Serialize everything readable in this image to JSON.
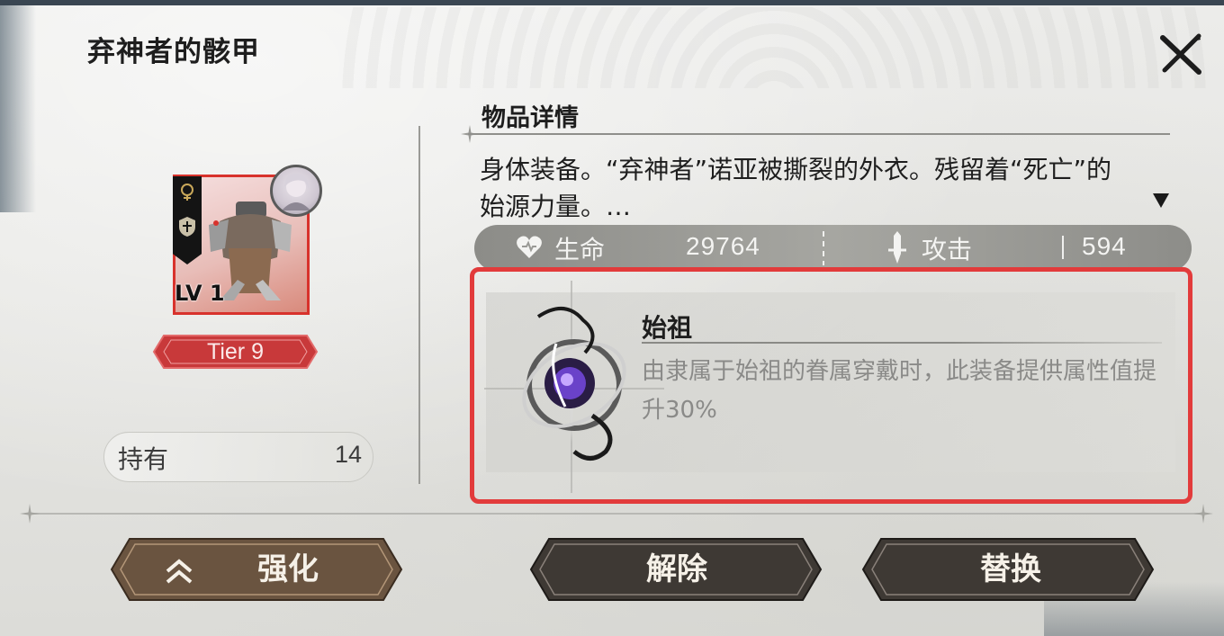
{
  "header": {
    "title": "弃神者的骸甲"
  },
  "item": {
    "level_label": "LV 1",
    "tier_label": "Tier 9",
    "hold": {
      "label": "持有",
      "value": "14"
    }
  },
  "details": {
    "section_title": "物品详情",
    "description": "身体装备。“弃神者”诺亚被撕裂的外衣。残留着“死亡”的始源力量。…",
    "stats": [
      {
        "icon": "heart-icon",
        "label": "生命",
        "value": "29764"
      },
      {
        "icon": "sword-icon",
        "label": "攻击",
        "value": "594"
      }
    ],
    "passive": {
      "name": "始祖",
      "description": "由隶属于始祖的眷属穿戴时，此装备提供属性值提升30%"
    }
  },
  "buttons": {
    "enhance": "强化",
    "unequip": "解除",
    "replace": "替换"
  },
  "colors": {
    "highlight": "#e23b3b",
    "card_border": "#d8322c",
    "tier_bg": "#c8393a",
    "button_bg": "#3e3934"
  }
}
